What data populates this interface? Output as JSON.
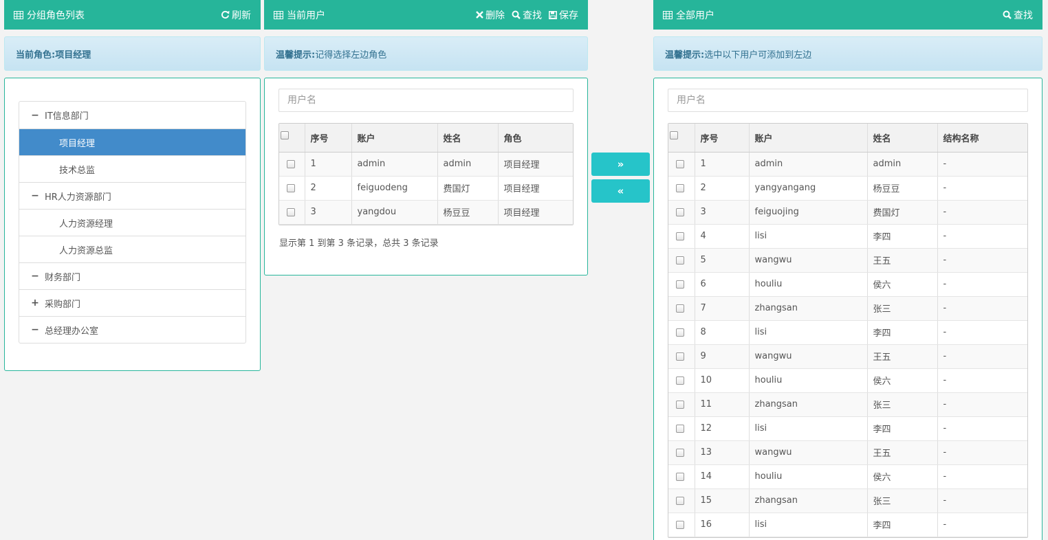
{
  "left_panel": {
    "title": "分组角色列表",
    "refresh_label": "刷新",
    "hint": {
      "label": "当前角色:",
      "value": "项目经理"
    },
    "tree": [
      {
        "label": "IT信息部门",
        "toggle": "−",
        "level": 0,
        "active": false
      },
      {
        "label": "项目经理",
        "level": 1,
        "active": true
      },
      {
        "label": "技术总监",
        "level": 1,
        "active": false
      },
      {
        "label": "HR人力资源部门",
        "toggle": "−",
        "level": 0,
        "active": false
      },
      {
        "label": "人力资源经理",
        "level": 1,
        "active": false
      },
      {
        "label": "人力资源总监",
        "level": 1,
        "active": false
      },
      {
        "label": "财务部门",
        "toggle": "−",
        "level": 0,
        "active": false
      },
      {
        "label": "采购部门",
        "toggle": "+",
        "level": 0,
        "active": false
      },
      {
        "label": "总经理办公室",
        "toggle": "−",
        "level": 0,
        "active": false
      }
    ]
  },
  "middle_panel": {
    "title": "当前用户",
    "delete_label": "删除",
    "find_label": "查找",
    "save_label": "保存",
    "hint": {
      "label": "温馨提示:",
      "value": "记得选择左边角色"
    },
    "search_placeholder": "用户名",
    "columns": [
      "序号",
      "账户",
      "姓名",
      "角色"
    ],
    "rows": [
      [
        "1",
        "admin",
        "admin",
        "项目经理"
      ],
      [
        "2",
        "feiguodeng",
        "费国灯",
        "项目经理"
      ],
      [
        "3",
        "yangdou",
        "杨豆豆",
        "项目经理"
      ]
    ],
    "pager": "显示第 1 到第 3 条记录，总共 3 条记录"
  },
  "transfer": {
    "add_label": "»",
    "remove_label": "«"
  },
  "right_panel": {
    "title": "全部用户",
    "find_label": "查找",
    "hint": {
      "label": "温馨提示:",
      "value": "选中以下用户可添加到左边"
    },
    "search_placeholder": "用户名",
    "columns": [
      "序号",
      "账户",
      "姓名",
      "结构名称"
    ],
    "rows": [
      [
        "1",
        "admin",
        "admin",
        "-"
      ],
      [
        "2",
        "yangyangang",
        "杨豆豆",
        "-"
      ],
      [
        "3",
        "feiguojing",
        "费国灯",
        "-"
      ],
      [
        "4",
        "lisi",
        "李四",
        "-"
      ],
      [
        "5",
        "wangwu",
        "王五",
        "-"
      ],
      [
        "6",
        "houliu",
        "侯六",
        "-"
      ],
      [
        "7",
        "zhangsan",
        "张三",
        "-"
      ],
      [
        "8",
        "lisi",
        "李四",
        "-"
      ],
      [
        "9",
        "wangwu",
        "王五",
        "-"
      ],
      [
        "10",
        "houliu",
        "侯六",
        "-"
      ],
      [
        "11",
        "zhangsan",
        "张三",
        "-"
      ],
      [
        "12",
        "lisi",
        "李四",
        "-"
      ],
      [
        "13",
        "wangwu",
        "王五",
        "-"
      ],
      [
        "14",
        "houliu",
        "侯六",
        "-"
      ],
      [
        "15",
        "zhangsan",
        "张三",
        "-"
      ],
      [
        "16",
        "lisi",
        "李四",
        "-"
      ]
    ]
  },
  "colors": {
    "header_green": "#26b59a",
    "active_blue": "#428bca",
    "transfer_teal": "#26c4c9",
    "hint_text": "#31708f"
  }
}
